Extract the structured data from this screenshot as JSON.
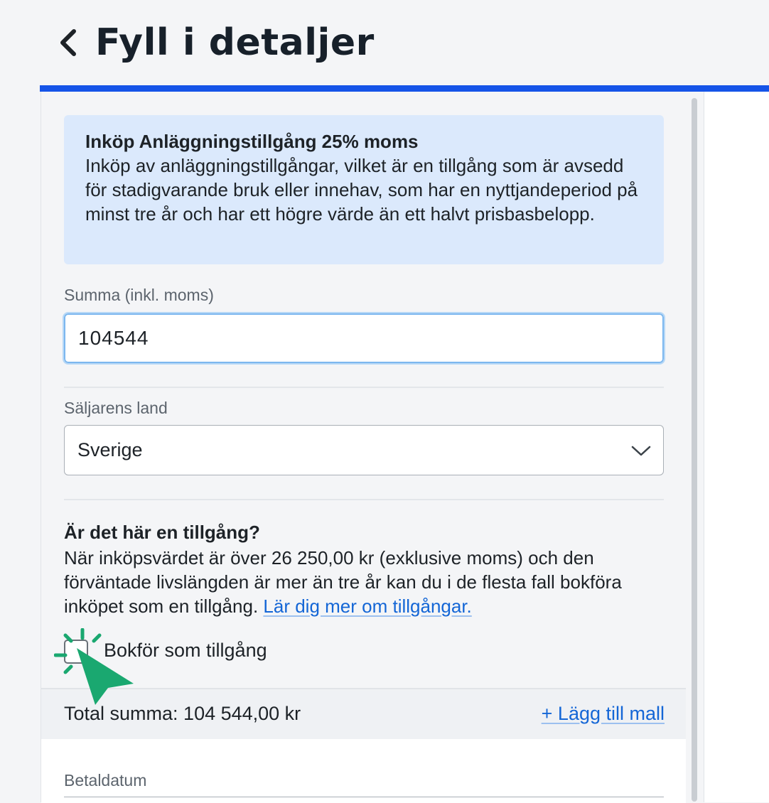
{
  "header": {
    "title": "Fyll i detaljer",
    "back_icon": "chevron-left-icon",
    "progress_color": "#1554e8"
  },
  "info_box": {
    "title": "Inköp Anläggningstillgång 25% moms",
    "text": "Inköp av anläggningstillgångar, vilket är en tillgång som är avsedd för stadigvarande bruk eller innehav, som har en nyttjandeperiod på minst tre år och har ett högre värde än ett halvt prisbasbelopp.",
    "background": "#dbe9fc"
  },
  "amount": {
    "label": "Summa (inkl. moms)",
    "value": "104544"
  },
  "seller_country": {
    "label": "Säljarens land",
    "selected": "Sverige"
  },
  "asset": {
    "heading": "Är det här en tillgång?",
    "text": "När inköpsvärdet är över 26 250,00 kr (exklusive moms) och den förväntade livslängden är mer än tre år kan du i de flesta fall bokföra inköpet som en tillgång.",
    "link": "Lär dig mer om tillgångar.",
    "checkbox_label": "Bokför som tillgång",
    "checkbox_checked": false
  },
  "total": {
    "text": "Total summa: 104 544,00 kr",
    "add_template": "+ Lägg till mall"
  },
  "payment_date": {
    "label": "Betaldatum"
  },
  "colors": {
    "link": "#1466d6",
    "click_indicator": "#1aa870"
  }
}
